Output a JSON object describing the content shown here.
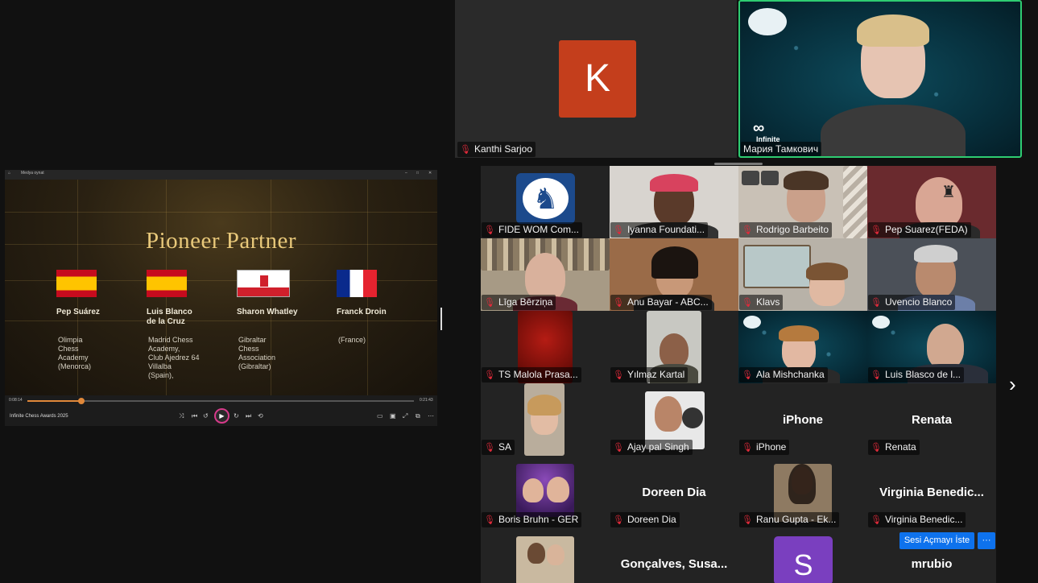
{
  "shared_screen": {
    "window_title": "Medya oynat",
    "slide": {
      "title": "Pioneer Partner",
      "partners": [
        {
          "name": "Pep Suárez",
          "org": "Olimpia\nChess\nAcademy\n(Menorca)",
          "flag": "spain"
        },
        {
          "name": "Luis Blanco\nde la Cruz",
          "org": "Madrid Chess\nAcademy,\nClub Ajedrez 64\nVillalba\n(Spain),",
          "flag": "spain"
        },
        {
          "name": "Sharon Whatley",
          "org": "Gibraltar\nChess\nAssociation\n(Gibraltar)",
          "flag": "gibraltar"
        },
        {
          "name": "Franck Droin",
          "org": "(France)",
          "flag": "france"
        }
      ]
    },
    "player": {
      "media_title": "Infinite Chess Awards 2025",
      "elapsed": "0:08:14",
      "duration": "0:21:43",
      "progress": 0.14
    }
  },
  "top_tiles": [
    {
      "name": "Kanthi Sarjoo",
      "avatar_letter": "K",
      "avatar_color": "#c43e1c"
    },
    {
      "name": "Мария Тамкович",
      "active_speaker": true,
      "logo_text": "Infinite"
    }
  ],
  "gallery": [
    {
      "name": "FIDE WOM Com...",
      "kind": "logo"
    },
    {
      "name": "Iyanna Foundati...",
      "kind": "video"
    },
    {
      "name": "Rodrigo Barbeito",
      "kind": "video"
    },
    {
      "name": "Pep Suarez(FEDA)",
      "kind": "video"
    },
    {
      "name": "Līga Bērziņa",
      "kind": "video"
    },
    {
      "name": "Anu Bayar - ABC...",
      "kind": "video"
    },
    {
      "name": "Klavs",
      "kind": "video"
    },
    {
      "name": "Uvencio Blanco",
      "kind": "video"
    },
    {
      "name": "TS Malola Prasa...",
      "kind": "video"
    },
    {
      "name": "Yılmaz Kartal",
      "kind": "video"
    },
    {
      "name": "Ala Mishchanka",
      "kind": "video"
    },
    {
      "name": "Luis Blasco de l...",
      "kind": "video"
    },
    {
      "name": "SA",
      "kind": "photo"
    },
    {
      "name": "Ajay pal Singh",
      "kind": "photo"
    },
    {
      "name": "iPhone",
      "kind": "text",
      "center_text": "iPhone"
    },
    {
      "name": "Renata",
      "kind": "text",
      "center_text": "Renata"
    },
    {
      "name": "Boris Bruhn - GER",
      "kind": "photo"
    },
    {
      "name": "Doreen Dia",
      "kind": "text",
      "center_text": "Doreen Dia"
    },
    {
      "name": "Ranu Gupta - Ek...",
      "kind": "photo"
    },
    {
      "name": "Virginia  Benedic...",
      "kind": "text",
      "center_text": "Virginia  Benedic..."
    },
    {
      "name": "",
      "kind": "photo"
    },
    {
      "name": "",
      "kind": "text",
      "center_text": "Gonçalves,  Susa..."
    },
    {
      "name": "",
      "kind": "avatar",
      "avatar_letter": "S",
      "avatar_color": "#7a3fbf"
    },
    {
      "name": "",
      "kind": "text",
      "center_text": "mrubio"
    }
  ],
  "gallery_actions": {
    "ask_unmute_label": "Sesi Açmayı İste",
    "more_label": "···"
  },
  "icons": {
    "muted": "mic-muted-icon",
    "next": "chevron-right-icon"
  },
  "colors": {
    "active_speaker_border": "#2ecc71",
    "muted_mic": "#e02a3a",
    "button_blue": "#0e72ed"
  }
}
